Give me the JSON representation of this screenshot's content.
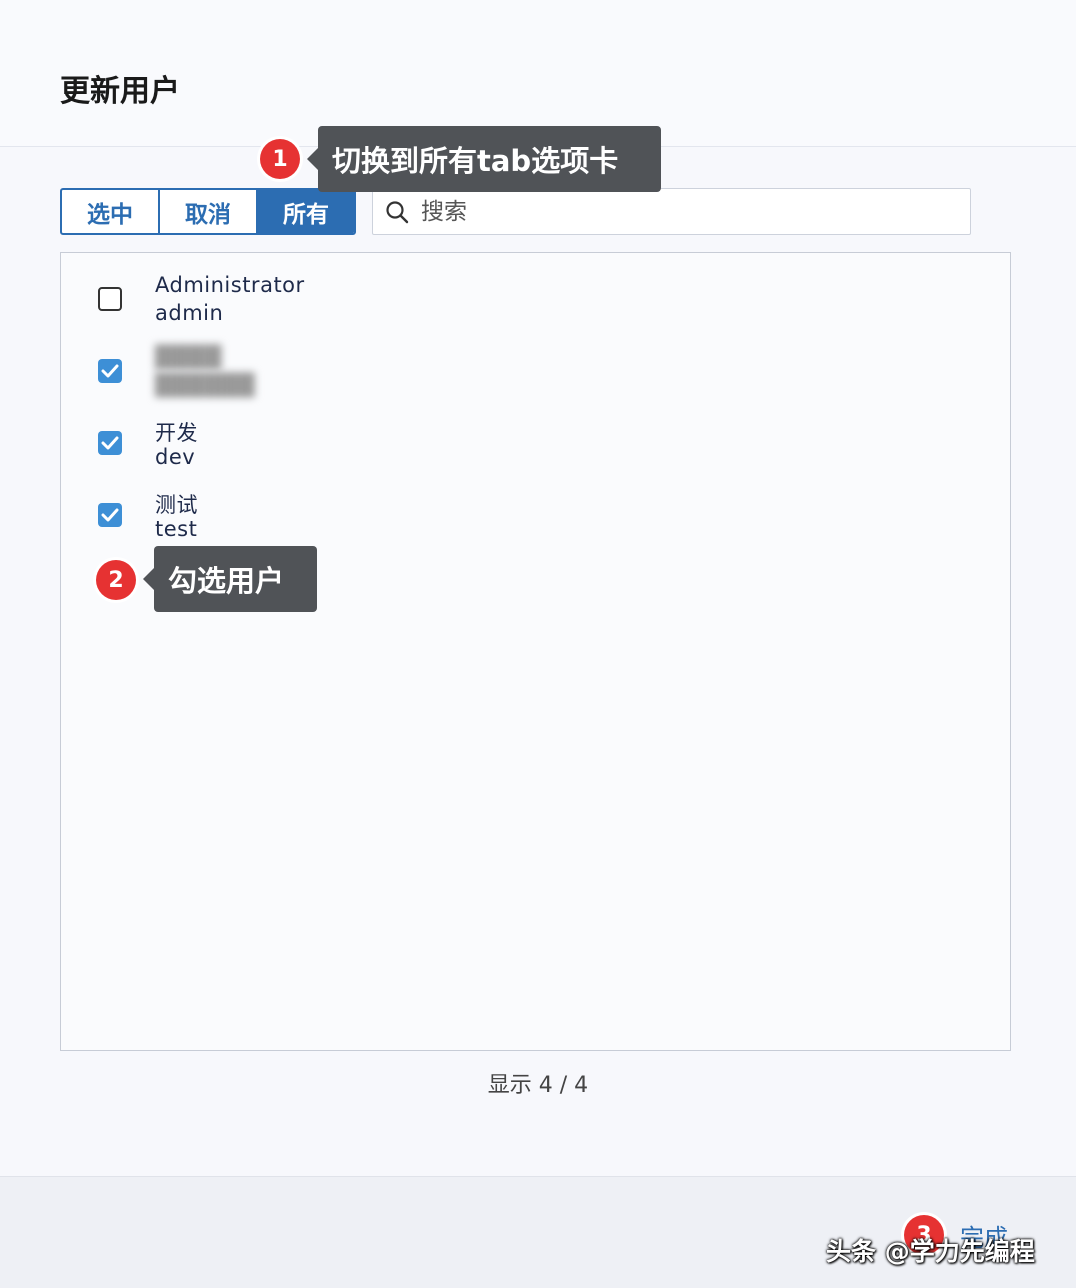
{
  "dialog": {
    "title": "更新用户"
  },
  "tabs": [
    {
      "label": "选中",
      "active": false
    },
    {
      "label": "取消",
      "active": false
    },
    {
      "label": "所有",
      "active": true
    }
  ],
  "search": {
    "placeholder": "搜索"
  },
  "users": [
    {
      "name": "Administrator",
      "login": "admin",
      "checked": false
    },
    {
      "name": "████",
      "login": "██████",
      "checked": true,
      "blurred": true
    },
    {
      "name": "开发",
      "login": "dev",
      "checked": true
    },
    {
      "name": "测试",
      "login": "test",
      "checked": true
    }
  ],
  "count": {
    "text": "显示 4 / 4"
  },
  "footer": {
    "done_label": "完成"
  },
  "annotations": [
    {
      "number": "1",
      "text": "切换到所有tab选项卡"
    },
    {
      "number": "2",
      "text": "勾选用户"
    },
    {
      "number": "3"
    }
  ],
  "watermark": "头条 @学力先编程",
  "colors": {
    "primary": "#2c6db2",
    "checkbox": "#3d8fd6",
    "badge": "#e63232",
    "callout": "#505357"
  }
}
